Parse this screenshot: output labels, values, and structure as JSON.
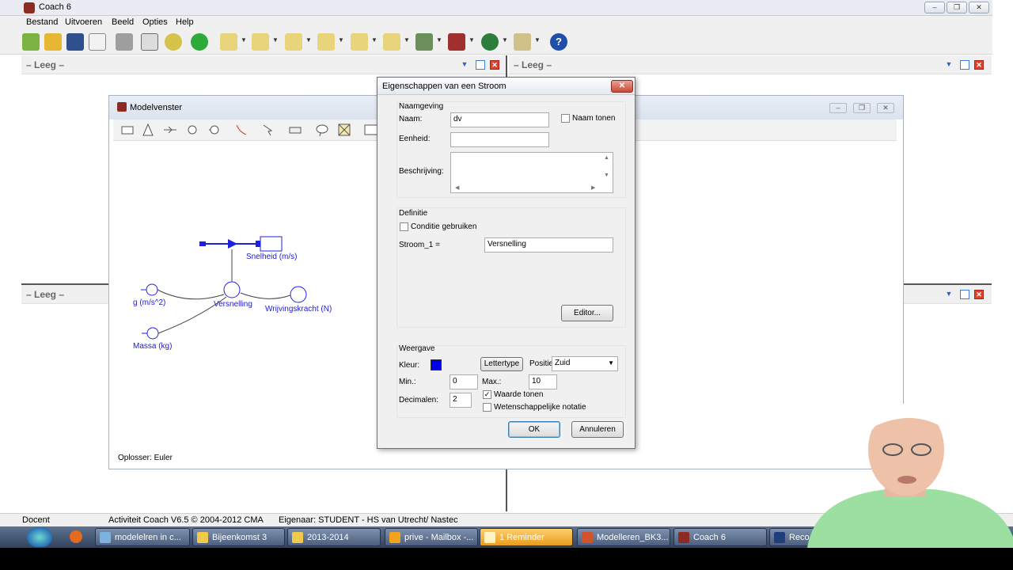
{
  "window": {
    "title": "Coach 6"
  },
  "menu": [
    "Bestand",
    "Uitvoeren",
    "Beeld",
    "Opties",
    "Help"
  ],
  "panels": {
    "top_left": "– Leeg –",
    "top_right": "– Leeg –",
    "bottom_left": "– Leeg –"
  },
  "model_window": {
    "title": "Modelvenster",
    "solver": "Oplosser: Euler",
    "labels": {
      "snelheid": "Snelheid (m/s)",
      "versnelling": "Versnelling",
      "g": "g (m/s^2)",
      "massa": "Massa (kg)",
      "wrijving": "Wrijvingskracht (N)"
    }
  },
  "dialog": {
    "title": "Eigenschappen van een Stroom",
    "naamgeving": {
      "group": "Naamgeving",
      "naam_label": "Naam:",
      "naam_value": "dv",
      "naam_tonen": "Naam tonen",
      "eenheid_label": "Eenheid:",
      "eenheid_value": "",
      "beschrijving_label": "Beschrijving:"
    },
    "definitie": {
      "group": "Definitie",
      "conditie": "Conditie gebruiken",
      "stroom_label": "Stroom_1 =",
      "stroom_value": "Versnelling",
      "editor": "Editor..."
    },
    "weergave": {
      "group": "Weergave",
      "kleur_label": "Kleur:",
      "kleur": "#0000e6",
      "lettertype": "Lettertype",
      "positie_label": "Positie:",
      "positie_value": "Zuid",
      "min_label": "Min.:",
      "min_value": "0",
      "max_label": "Max.:",
      "max_value": "10",
      "decimalen_label": "Decimalen:",
      "decimalen_value": "2",
      "waarde_tonen": "Waarde tonen",
      "wetenschappelijk": "Wetenschappelijke notatie"
    },
    "ok": "OK",
    "annuleren": "Annuleren"
  },
  "status": {
    "docent": "Docent",
    "activiteit": "Activiteit Coach V6.5 © 2004-2012 CMA",
    "eigenaar": "Eigenaar: STUDENT - HS van Utrecht/ Nastec"
  },
  "taskbar": [
    "modelelren in c...",
    "Bijeenkomst 3",
    "2013-2014",
    "prive - Mailbox -...",
    "1 Reminder",
    "Modelleren_BK3...",
    "Coach 6",
    "Reco"
  ]
}
